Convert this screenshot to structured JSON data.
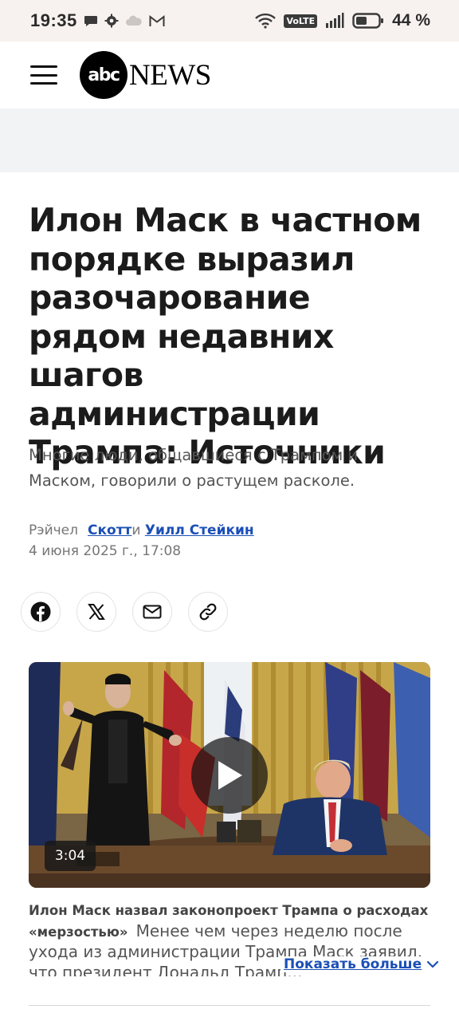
{
  "status_bar": {
    "time": "19:35",
    "network_badge": "VoLTE",
    "battery_percent": "44 %"
  },
  "header": {
    "logo_abc": "abc",
    "logo_news": "NEWS"
  },
  "article": {
    "headline": "Илон Маск в частном порядке выразил разочарование рядом недавних шагов администрации Трампа: Источники",
    "subheadline": "Многие люди, общавшиеся с Трампом и Маском, говорили о растущем расколе.",
    "byline": {
      "prefix": "Рэйчел",
      "author1": "Скотт",
      "conjunction": "и",
      "author2": "Уилл Стейкин"
    },
    "date": "4 июня 2025 г., 17:08"
  },
  "share": {
    "buttons": [
      "facebook-icon",
      "x-icon",
      "mail-icon",
      "link-icon"
    ]
  },
  "video": {
    "duration": "3:04",
    "caption_title": "Илон Маск назвал законопроект Трампа о расходах «мерзостью»",
    "caption_text": "Менее чем через неделю после ухода из администрации Трампа Маск заявил, что президент Дональд Трамп...",
    "show_more": "Показать больше"
  },
  "colors": {
    "link": "#1b4fb6",
    "status_bg": "#f7f2ef",
    "ad_bg": "#f2f3f5"
  }
}
